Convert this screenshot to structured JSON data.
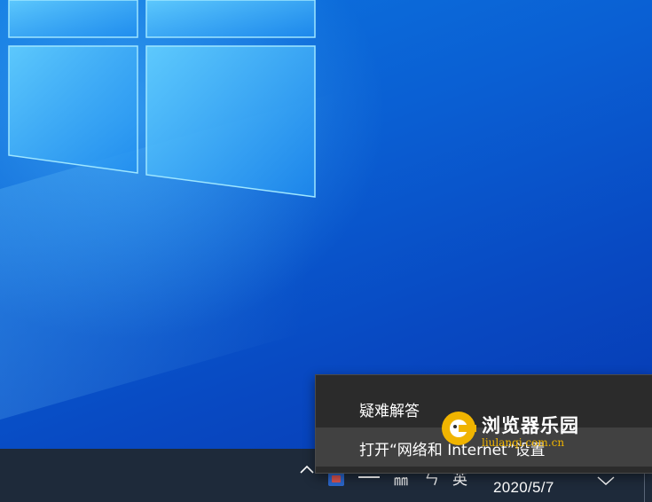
{
  "context_menu": {
    "items": [
      {
        "label": "疑难解答"
      },
      {
        "label": "打开“网络和 Internet”设置"
      }
    ]
  },
  "taskbar": {
    "tray": {
      "volume_glyph": "㎜",
      "ime_glyph_1": "ㄣ",
      "ime_glyph_2": "英"
    },
    "clock": {
      "date": "2020/5/7"
    }
  },
  "watermark": {
    "text": "浏览器乐园",
    "url": "liulanqi.com.cn"
  },
  "icons": {
    "tray_expand": "chevron-up-icon",
    "tray_app": "app-icon",
    "network": "network-icon",
    "volume": "volume-icon",
    "ime": "ime-icon",
    "notification": "notification-icon",
    "logo": "windows-logo-icon"
  },
  "colors": {
    "desktop_accent": "#0a5fd3",
    "taskbar": "#1e2a3a",
    "menu_bg": "#2b2b2b",
    "menu_hover": "#414141",
    "watermark_text": "#ffffff",
    "watermark_url": "#f0b400"
  }
}
